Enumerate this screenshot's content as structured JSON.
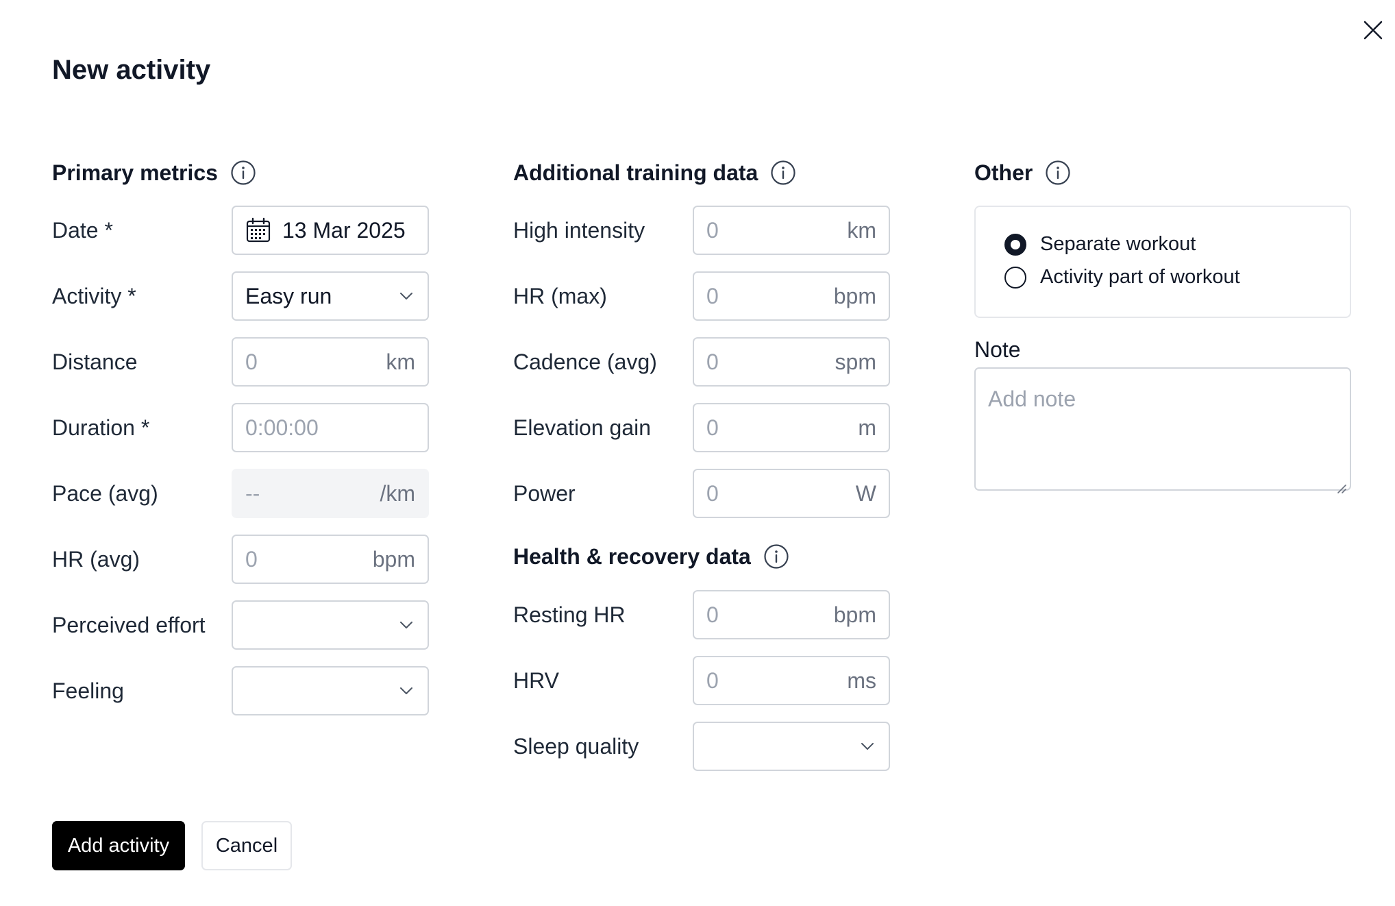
{
  "dialog": {
    "title": "New activity",
    "close_icon": "close-icon"
  },
  "primary": {
    "heading": "Primary metrics",
    "rows": {
      "date": {
        "label": "Date *",
        "value": "13 Mar 2025",
        "icon": "calendar-icon"
      },
      "activity": {
        "label": "Activity *",
        "value": "Easy run",
        "icon": "chevron-down-icon"
      },
      "distance": {
        "label": "Distance",
        "placeholder": "0",
        "unit": "km"
      },
      "duration": {
        "label": "Duration *",
        "placeholder": "0:00:00"
      },
      "pace": {
        "label": "Pace (avg)",
        "placeholder": "--",
        "unit": "/km"
      },
      "hr": {
        "label": "HR (avg)",
        "placeholder": "0",
        "unit": "bpm"
      },
      "effort": {
        "label": "Perceived effort",
        "value": ""
      },
      "feeling": {
        "label": "Feeling",
        "value": ""
      }
    }
  },
  "additional": {
    "heading": "Additional training data",
    "rows": {
      "high_intensity": {
        "label": "High intensity",
        "placeholder": "0",
        "unit": "km"
      },
      "hr_max": {
        "label": "HR (max)",
        "placeholder": "0",
        "unit": "bpm"
      },
      "cadence": {
        "label": "Cadence (avg)",
        "placeholder": "0",
        "unit": "spm"
      },
      "elevation": {
        "label": "Elevation gain",
        "placeholder": "0",
        "unit": "m"
      },
      "power": {
        "label": "Power",
        "placeholder": "0",
        "unit": "W"
      }
    }
  },
  "health": {
    "heading": "Health & recovery data",
    "rows": {
      "resting_hr": {
        "label": "Resting HR",
        "placeholder": "0",
        "unit": "bpm"
      },
      "hrv": {
        "label": "HRV",
        "placeholder": "0",
        "unit": "ms"
      },
      "sleep": {
        "label": "Sleep quality",
        "value": ""
      }
    }
  },
  "other": {
    "heading": "Other",
    "options": [
      {
        "label": "Separate workout",
        "checked": true
      },
      {
        "label": "Activity part of workout",
        "checked": false
      }
    ],
    "note_label": "Note",
    "note_placeholder": "Add note"
  },
  "actions": {
    "submit": "Add activity",
    "cancel": "Cancel"
  }
}
